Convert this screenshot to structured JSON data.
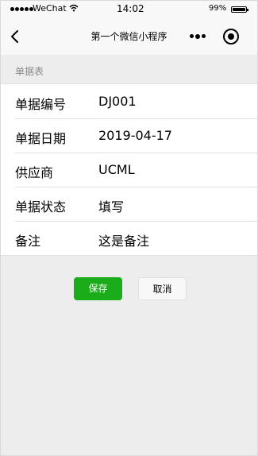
{
  "status_bar": {
    "carrier": "WeChat",
    "time": "14:02",
    "battery_pct": "99%",
    "wifi_icon": "wifi-icon",
    "battery_level": 0.99
  },
  "nav": {
    "title": "第一个微信小程序",
    "back_icon": "chevron-left-icon",
    "more_icon": "more-dots-icon",
    "close_icon": "target-circle-icon"
  },
  "form": {
    "section_title": "单据表",
    "rows": [
      {
        "label": "单据编号",
        "value": "DJ001"
      },
      {
        "label": "单据日期",
        "value": "2019-04-17"
      },
      {
        "label": "供应商",
        "value": "UCML"
      },
      {
        "label": "单据状态",
        "value": "填写"
      },
      {
        "label": "备注",
        "value": "这是备注"
      }
    ]
  },
  "actions": {
    "save_label": "保存",
    "cancel_label": "取消"
  },
  "colors": {
    "primary": "#1aad19",
    "background": "#ededed",
    "navbar": "#f8f8f8"
  }
}
